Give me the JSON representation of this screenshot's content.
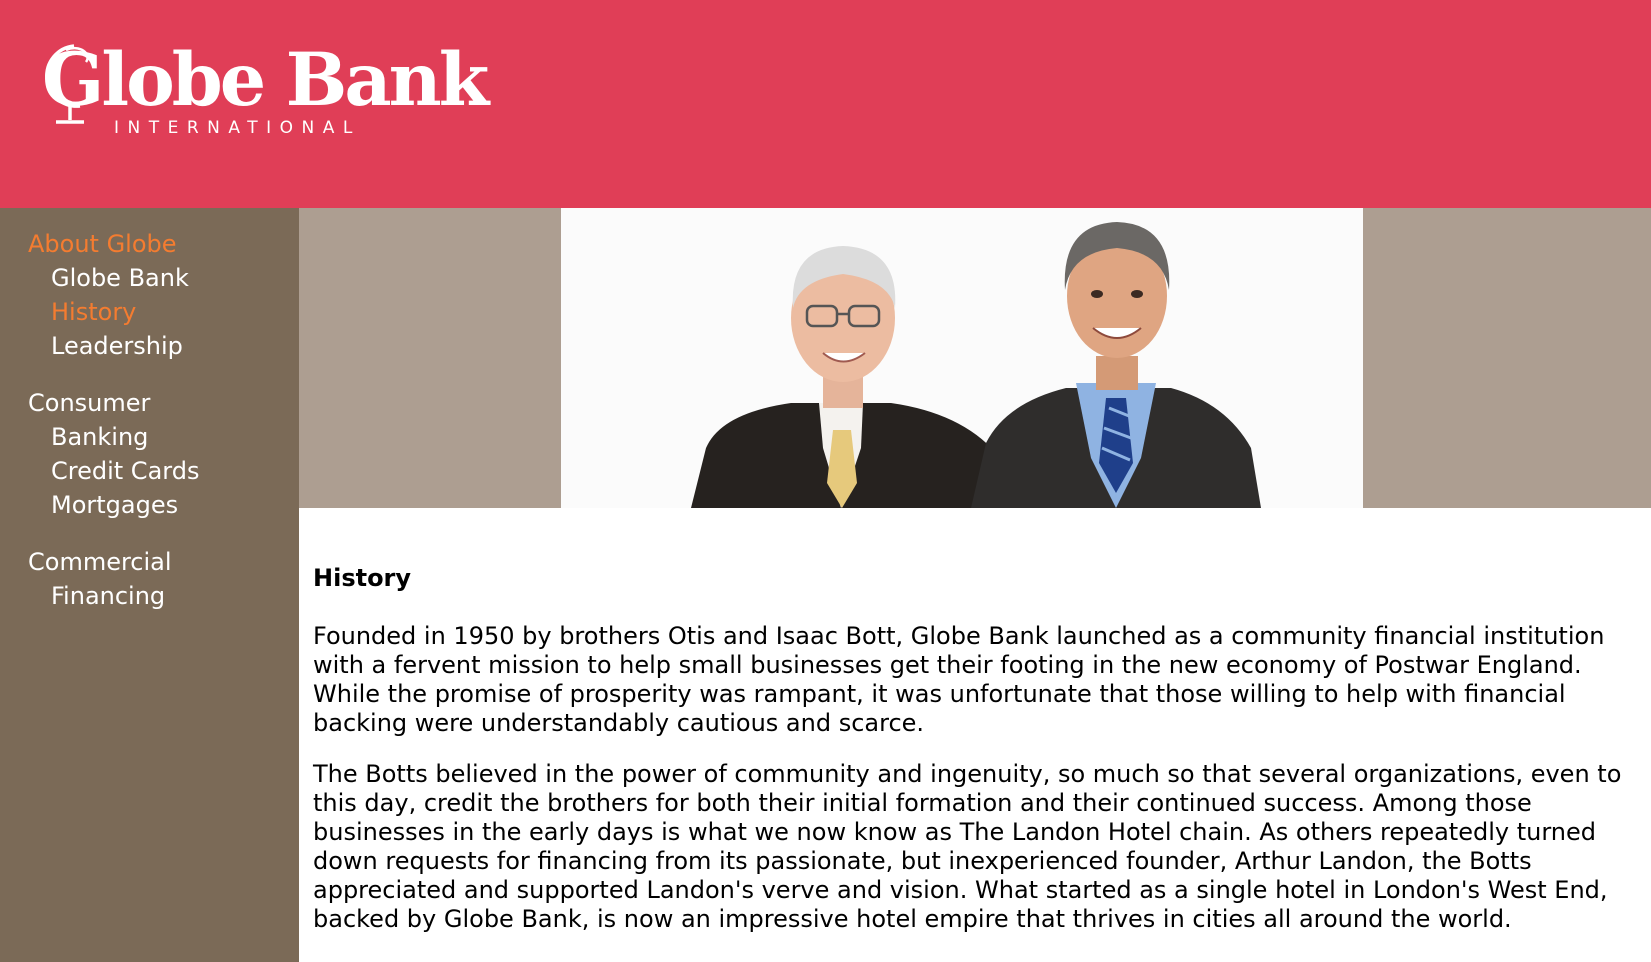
{
  "header": {
    "brand_name": "Globe Bank",
    "brand_subtitle": "INTERNATIONAL",
    "colors": {
      "header_bg": "#e03e57",
      "sidebar_bg": "#7b6a57",
      "hero_bg": "#ad9e91",
      "active_link": "#f47c30"
    }
  },
  "sidebar": {
    "sections": [
      {
        "title": "About Globe",
        "active": true,
        "items": [
          {
            "label": "Globe Bank",
            "active": false
          },
          {
            "label": "History",
            "active": true
          },
          {
            "label": "Leadership",
            "active": false
          }
        ]
      },
      {
        "title": "Consumer",
        "active": false,
        "items": [
          {
            "label": "Banking",
            "active": false
          },
          {
            "label": "Credit Cards",
            "active": false
          },
          {
            "label": "Mortgages",
            "active": false
          }
        ]
      },
      {
        "title": "Commercial",
        "active": false,
        "items": [
          {
            "label": "Financing",
            "active": false
          }
        ]
      }
    ]
  },
  "hero": {
    "image": "two-businessmen-photo"
  },
  "main": {
    "heading": "History",
    "paragraphs": [
      "Founded in 1950 by brothers Otis and Isaac Bott, Globe Bank launched as a community financial institution with a fervent mission to help small businesses get their footing in the new economy of Postwar England. While the promise of prosperity was rampant, it was unfortunate that those willing to help with financial backing were understandably cautious and scarce.",
      "The Botts believed in the power of community and ingenuity, so much so that several organizations, even to this day, credit the brothers for both their initial formation and their continued success. Among those businesses in the early days is what we now know as The Landon Hotel chain. As others repeatedly turned down requests for financing from its passionate, but inexperienced founder, Arthur Landon, the Botts appreciated and supported Landon's verve and vision. What started as a single hotel in London's West End, backed by Globe Bank, is now an impressive hotel empire that thrives in cities all around the world."
    ]
  }
}
